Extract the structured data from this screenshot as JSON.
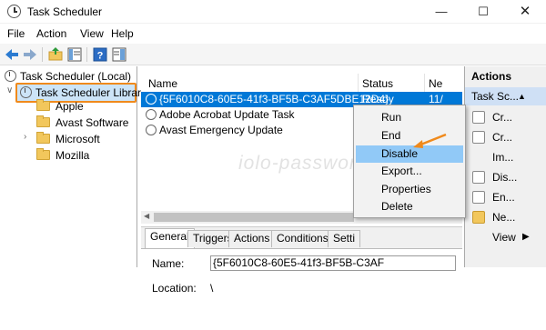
{
  "window": {
    "title": "Task Scheduler"
  },
  "menu": [
    "File",
    "Action",
    "View",
    "Help"
  ],
  "tree": {
    "root": "Task Scheduler (Local)",
    "library": "Task Scheduler Library",
    "folders": [
      "Apple",
      "Avast Software",
      "Microsoft",
      "Mozilla"
    ]
  },
  "task_list": {
    "headers": {
      "name": "Name",
      "status": "Status",
      "next": "Ne"
    },
    "rows": [
      {
        "name": "{5F6010C8-60E5-41f3-BF5B-C3AF5DBE12D4}",
        "status": "Ready",
        "next": "11/"
      },
      {
        "name": "Adobe Acrobat Update Task",
        "status": "",
        "next": ""
      },
      {
        "name": "Avast Emergency Update",
        "status": "",
        "next": ""
      }
    ]
  },
  "details": {
    "tabs": [
      "General",
      "Triggers",
      "Actions",
      "Conditions",
      "Setti"
    ],
    "name_label": "Name:",
    "name_value": "{5F6010C8-60E5-41f3-BF5B-C3AF",
    "location_label": "Location:",
    "location_value": "\\"
  },
  "actions": {
    "heading": "Actions",
    "group": "Task Sc...",
    "items": [
      "Cr...",
      "Cr...",
      "Im...",
      "Dis...",
      "En...",
      "Ne...",
      "View"
    ]
  },
  "context_menu": [
    "Run",
    "End",
    "Disable",
    "Export...",
    "Properties",
    "Delete"
  ],
  "watermark": "iolo-password.com",
  "colors": {
    "selection": "#0078d7",
    "highlight_border": "#f08a1c",
    "menu_hover": "#91c9f7"
  }
}
